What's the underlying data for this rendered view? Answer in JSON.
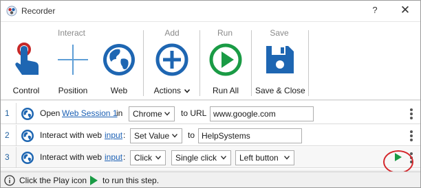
{
  "window": {
    "title": "Recorder",
    "help_label": "?",
    "close_label": "✕"
  },
  "ribbon": {
    "groups": [
      {
        "title": "Interact",
        "buttons": [
          {
            "label": "Control",
            "icon": "touch-hand-icon"
          },
          {
            "label": "Position",
            "icon": "crosshair-icon"
          },
          {
            "label": "Web",
            "icon": "globe-icon"
          }
        ]
      },
      {
        "title": "Add",
        "buttons": [
          {
            "label": "Actions",
            "icon": "plus-circle-icon",
            "has_menu": true
          }
        ]
      },
      {
        "title": "Run",
        "buttons": [
          {
            "label": "Run All",
            "icon": "play-circle-icon"
          }
        ]
      },
      {
        "title": "Save",
        "buttons": [
          {
            "label": "Save & Close",
            "icon": "floppy-disk-icon"
          }
        ]
      }
    ]
  },
  "steps": [
    {
      "number": "1",
      "open": "Open",
      "session_link": "Web Session 1",
      "in": "in",
      "browser": "Chrome",
      "to_url": "to URL",
      "url": "www.google.com"
    },
    {
      "number": "2",
      "interact": "Interact with web",
      "input_link": "input",
      "colon": ":",
      "action": "Set Value",
      "to": "to",
      "value": "HelpSystems"
    },
    {
      "number": "3",
      "interact": "Interact with web",
      "input_link": "input",
      "colon": ":",
      "action": "Click",
      "click_type": "Single click",
      "button": "Left button"
    }
  ],
  "status": {
    "text_before": "Click the Play icon",
    "text_after": "to run this step."
  },
  "colors": {
    "brand_blue": "#1e66b2",
    "run_green": "#1a9b45",
    "highlight_red": "#d4262b",
    "link_blue": "#1a5fb4"
  }
}
